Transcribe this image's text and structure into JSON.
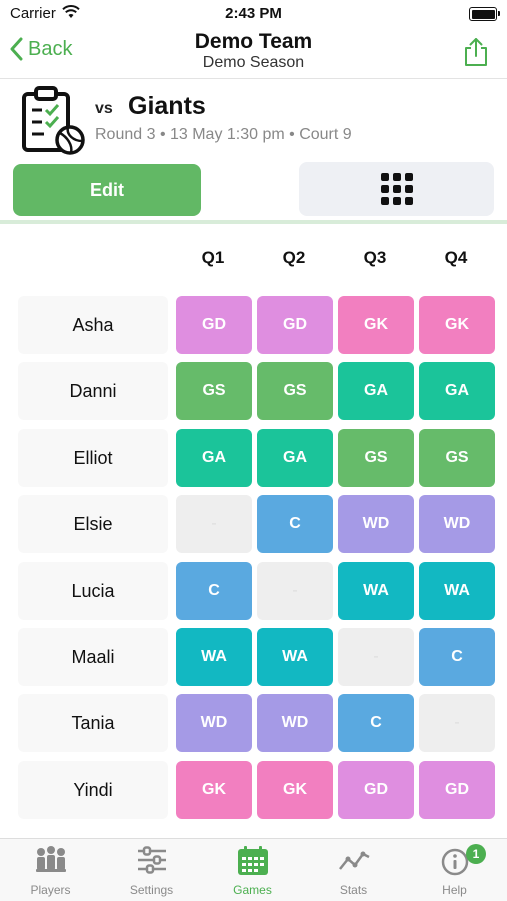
{
  "status_bar": {
    "carrier": "Carrier",
    "time": "2:43 PM"
  },
  "nav": {
    "back_label": "Back",
    "title": "Demo Team",
    "subtitle": "Demo Season"
  },
  "game": {
    "vs": "vs",
    "opponent": "Giants",
    "details": "Round 3 • 13 May 1:30 pm • Court 9"
  },
  "buttons": {
    "edit_label": "Edit"
  },
  "quarters": [
    "Q1",
    "Q2",
    "Q3",
    "Q4"
  ],
  "position_colors": {
    "GS": "#66bb6a",
    "GA": "#1bc49a",
    "WA": "#12b8c2",
    "C": "#5aa9e0",
    "WD": "#a59ae6",
    "GD": "#df8ee0",
    "GK": "#f27fc0",
    "-": "#eeeeee"
  },
  "players": [
    {
      "name": "Asha",
      "positions": [
        "GD",
        "GD",
        "GK",
        "GK"
      ]
    },
    {
      "name": "Danni",
      "positions": [
        "GS",
        "GS",
        "GA",
        "GA"
      ]
    },
    {
      "name": "Elliot",
      "positions": [
        "GA",
        "GA",
        "GS",
        "GS"
      ]
    },
    {
      "name": "Elsie",
      "positions": [
        "-",
        "C",
        "WD",
        "WD"
      ]
    },
    {
      "name": "Lucia",
      "positions": [
        "C",
        "-",
        "WA",
        "WA"
      ]
    },
    {
      "name": "Maali",
      "positions": [
        "WA",
        "WA",
        "-",
        "C"
      ]
    },
    {
      "name": "Tania",
      "positions": [
        "WD",
        "WD",
        "C",
        "-"
      ]
    },
    {
      "name": "Yindi",
      "positions": [
        "GK",
        "GK",
        "GD",
        "GD"
      ]
    }
  ],
  "tabs": [
    {
      "label": "Players",
      "icon": "players-icon"
    },
    {
      "label": "Settings",
      "icon": "settings-sliders-icon"
    },
    {
      "label": "Games",
      "icon": "calendar-icon",
      "active": true
    },
    {
      "label": "Stats",
      "icon": "stats-line-icon"
    },
    {
      "label": "Help",
      "icon": "info-icon",
      "badge": "1"
    }
  ],
  "accent_color": "#4caf50"
}
